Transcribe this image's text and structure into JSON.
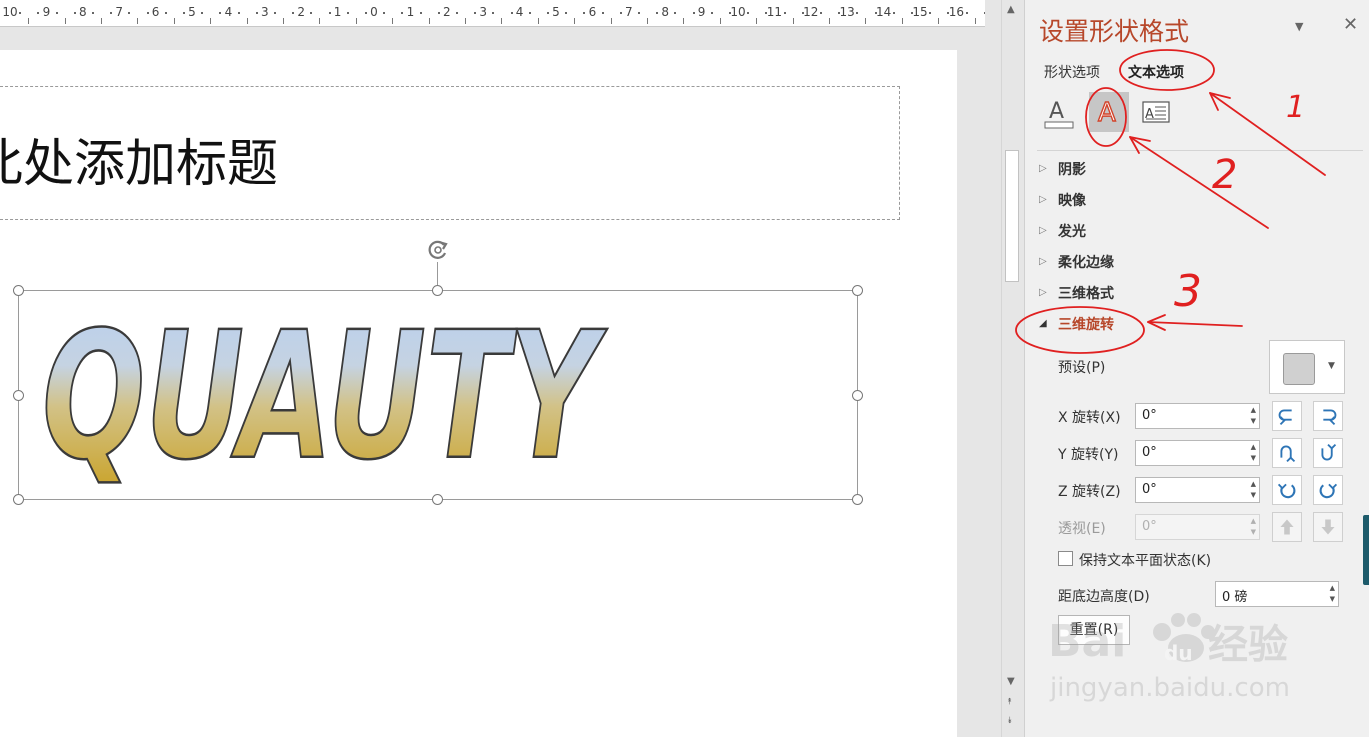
{
  "ruler": {
    "ticks": [
      "10",
      "9",
      "8",
      "7",
      "6",
      "5",
      "4",
      "3",
      "2",
      "1",
      "0",
      "1",
      "2",
      "3",
      "4",
      "5",
      "6",
      "7",
      "8",
      "9",
      "10",
      "11",
      "12",
      "13",
      "14",
      "15",
      "16"
    ]
  },
  "slide": {
    "title_placeholder": "此处添加标题",
    "wordart_text": "QUAUTY"
  },
  "pane": {
    "title": "设置形状格式",
    "tabs": {
      "shape_options": "形状选项",
      "text_options": "文本选项"
    },
    "sections": [
      "阴影",
      "映像",
      "发光",
      "柔化边缘",
      "三维格式",
      "三维旋转"
    ],
    "rotation": {
      "preset_label": "预设(P)",
      "x_label": "X 旋转(X)",
      "x_value": "0°",
      "y_label": "Y 旋转(Y)",
      "y_value": "0°",
      "z_label": "Z 旋转(Z)",
      "z_value": "0°",
      "perspective_label": "透视(E)",
      "perspective_value": "0°",
      "keep_flat_label": "保持文本平面状态(K)",
      "distance_label": "距底边高度(D)",
      "distance_value": "0 磅",
      "reset_label": "重置(R)"
    }
  },
  "annotations": [
    "1",
    "2",
    "3"
  ],
  "watermark": {
    "brand": "Baidu",
    "cn": "经验",
    "url": "jingyan.baidu.com"
  },
  "colors": {
    "accent": "#b7472a",
    "annotation": "#e02020",
    "wordart_top": "#b8cff0",
    "wordart_bottom": "#c9a020"
  }
}
